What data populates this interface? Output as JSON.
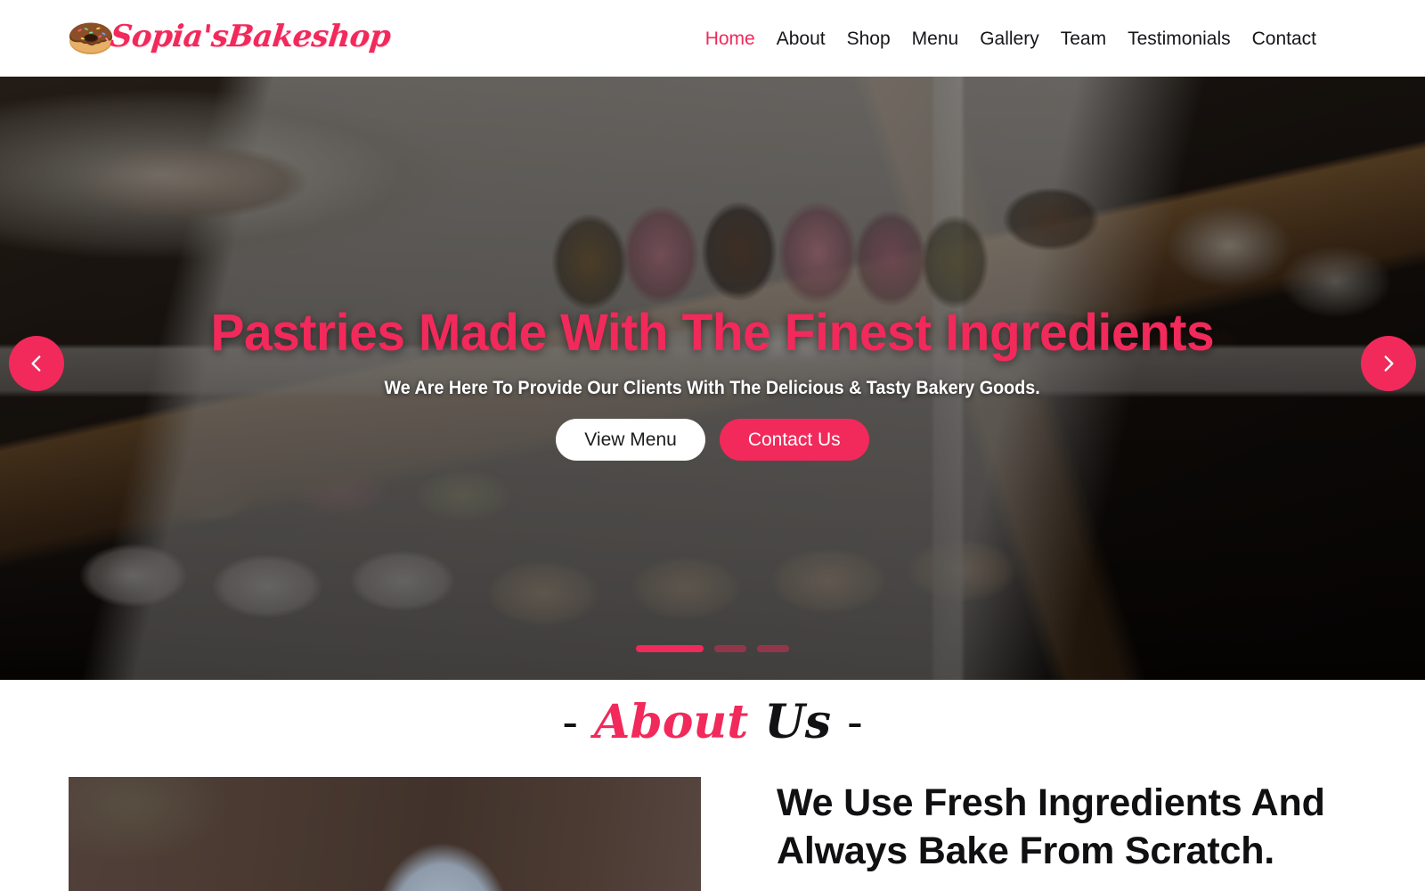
{
  "theme": {
    "accent": "#f2295b",
    "accent_muted": "#f2295b76",
    "text_dark": "#15161a",
    "white": "#ffffff"
  },
  "header": {
    "brand": {
      "name": "Sopia'sBakeshop",
      "icon": "donut-icon"
    },
    "nav": [
      {
        "label": "Home",
        "active": true
      },
      {
        "label": "About",
        "active": false
      },
      {
        "label": "Shop",
        "active": false
      },
      {
        "label": "Menu",
        "active": false
      },
      {
        "label": "Gallery",
        "active": false
      },
      {
        "label": "Team",
        "active": false
      },
      {
        "label": "Testimonials",
        "active": false
      },
      {
        "label": "Contact",
        "active": false
      }
    ]
  },
  "hero": {
    "title": "Pastries Made With The Finest Ingredients",
    "subtitle": "We Are Here To Provide Our Clients With The Delicious & Tasty Bakery Goods.",
    "primary_button": "View Menu",
    "secondary_button": "Contact Us",
    "prev_icon": "chevron-left-icon",
    "next_icon": "chevron-right-icon",
    "slide_count": 3,
    "active_slide": 1,
    "image_alt": "Bakery display case with cake pops, donuts and pastries on a wooden table"
  },
  "about": {
    "heading_dash_left": "-",
    "heading_accent": "About",
    "heading_rest": "Us",
    "heading_dash_right": "-",
    "title": "We Use Fresh Ingredients And Always Bake From Scratch.",
    "image_alt": "Baker wearing a blue cap in front of a dark brown wall"
  }
}
